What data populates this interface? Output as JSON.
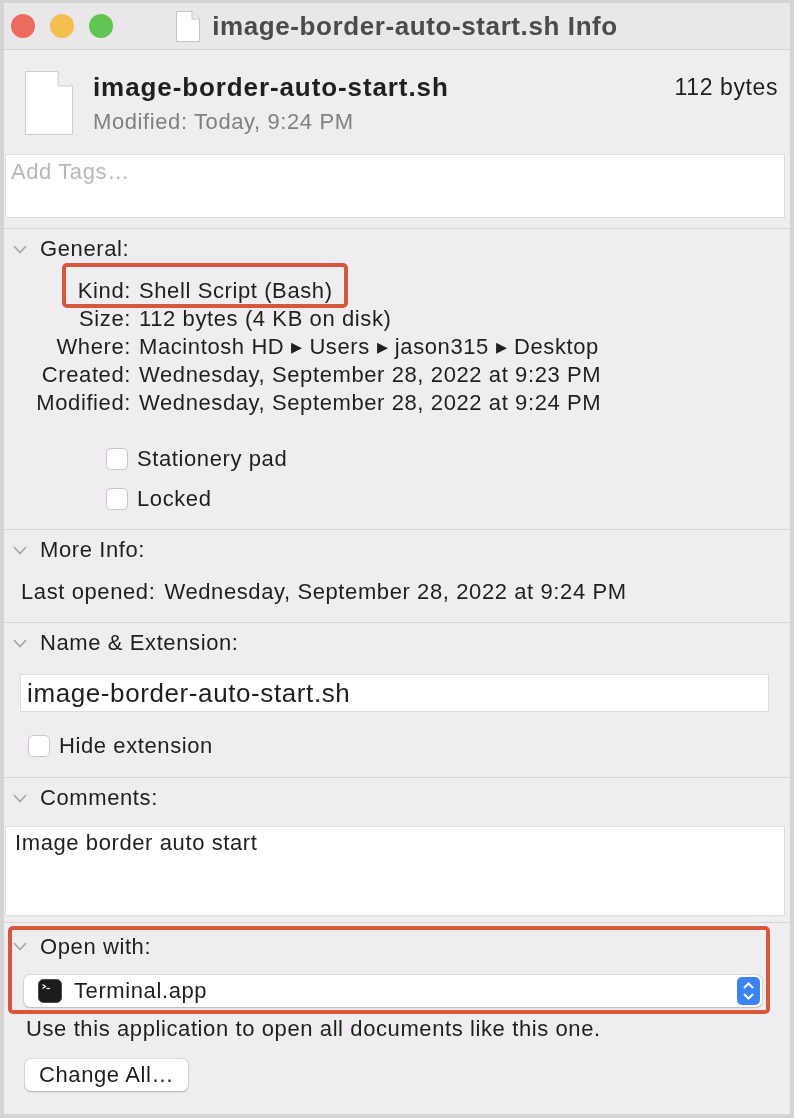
{
  "window": {
    "title": "image-border-auto-start.sh Info"
  },
  "file": {
    "name": "image-border-auto-start.sh",
    "modified": "Modified: Today, 9:24 PM",
    "size": "112 bytes"
  },
  "tags": {
    "placeholder": "Add Tags…"
  },
  "sections": [
    {
      "kind": "general",
      "title": "General:",
      "expanded": true,
      "highlighted": false,
      "rows": [
        {
          "label": "Kind:",
          "value": "Shell Script (Bash)",
          "highlighted": true
        },
        {
          "label": "Size:",
          "value": "112 bytes (4 KB on disk)",
          "highlighted": false
        },
        {
          "label": "Where:",
          "value": "Macintosh HD ▸ Users ▸ jason315 ▸ Desktop",
          "highlighted": false
        },
        {
          "label": "Created:",
          "value": "Wednesday, September 28, 2022 at 9:23 PM",
          "highlighted": false
        },
        {
          "label": "Modified:",
          "value": "Wednesday, September 28, 2022 at 9:24 PM",
          "highlighted": false
        }
      ],
      "checkboxes": [
        {
          "label": "Stationery pad",
          "checked": false
        },
        {
          "label": "Locked",
          "checked": false
        }
      ]
    },
    {
      "kind": "more_info",
      "title": "More Info:",
      "expanded": true,
      "highlighted": false,
      "rows": [
        {
          "label": "Last opened:",
          "value": "Wednesday, September 28, 2022 at 9:24 PM",
          "highlighted": false
        }
      ]
    },
    {
      "kind": "name_extension",
      "title": "Name & Extension:",
      "expanded": true,
      "highlighted": false,
      "value": "image-border-auto-start.sh",
      "checkboxes": [
        {
          "label": "Hide extension",
          "checked": false
        }
      ]
    },
    {
      "kind": "comments",
      "title": "Comments:",
      "expanded": true,
      "highlighted": false,
      "value": "Image border auto start"
    },
    {
      "kind": "open_with",
      "title": "Open with:",
      "expanded": true,
      "highlighted": true,
      "app": "Terminal.app",
      "note": "Use this application to open all documents like this one.",
      "button": "Change All…"
    }
  ]
}
